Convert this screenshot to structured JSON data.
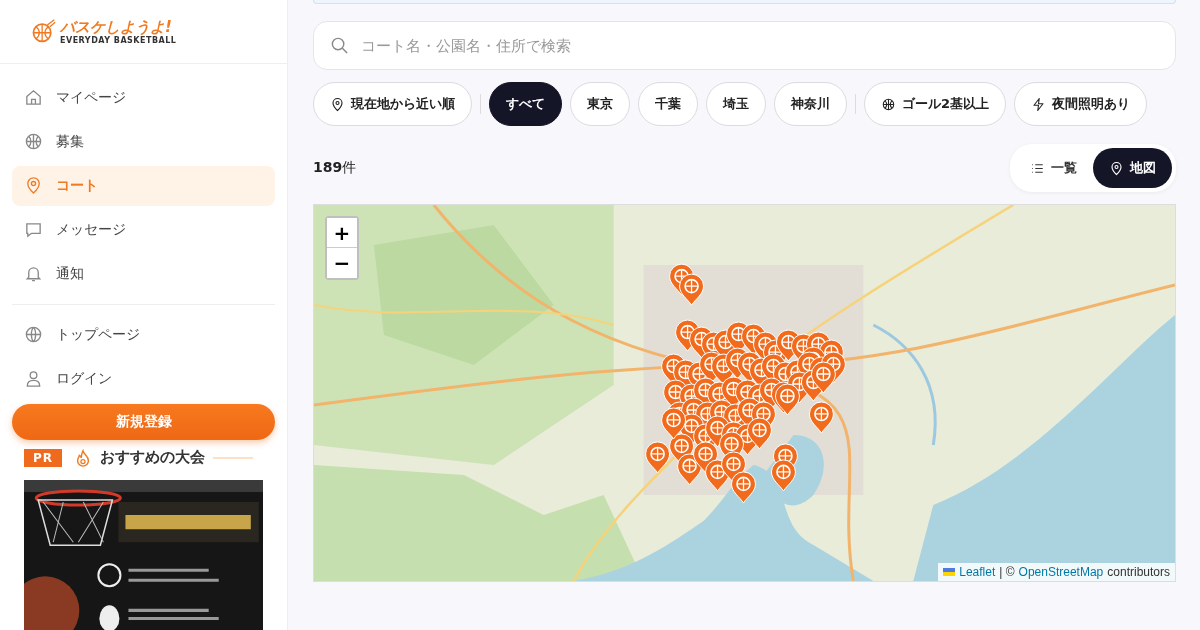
{
  "logo": {
    "title": "バスケしようよ!",
    "tagline": "EVERYDAY BASKETBALL"
  },
  "sidebar": {
    "items": [
      {
        "label": "マイページ",
        "kind": "home",
        "selected": false
      },
      {
        "label": "募集",
        "kind": "ball",
        "selected": false
      },
      {
        "label": "コート",
        "kind": "pin",
        "selected": true
      },
      {
        "label": "メッセージ",
        "kind": "chat",
        "selected": false
      },
      {
        "label": "通知",
        "kind": "bell",
        "selected": false
      },
      {
        "label": "トップページ",
        "kind": "globe",
        "selected": false
      },
      {
        "label": "ログイン",
        "kind": "user",
        "selected": false
      }
    ],
    "signup_button": "新規登録",
    "pr": {
      "badge": "PR",
      "title": "おすすめの大会"
    }
  },
  "search": {
    "placeholder": "コート名・公園名・住所で検索"
  },
  "filters": [
    {
      "label": "現在地から近い順",
      "kind": "sort",
      "selected": false
    },
    {
      "label": "すべて",
      "kind": "region",
      "selected": true
    },
    {
      "label": "東京",
      "kind": "region",
      "selected": false
    },
    {
      "label": "千葉",
      "kind": "region",
      "selected": false
    },
    {
      "label": "埼玉",
      "kind": "region",
      "selected": false
    },
    {
      "label": "神奈川",
      "kind": "region",
      "selected": false
    },
    {
      "label": "ゴール2基以上",
      "kind": "goals",
      "selected": false
    },
    {
      "label": "夜間照明あり",
      "kind": "lights",
      "selected": false
    }
  ],
  "result_count": {
    "number": "189",
    "unit": "件"
  },
  "view_toggle": [
    {
      "label": "一覧",
      "kind": "list",
      "selected": false
    },
    {
      "label": "地図",
      "kind": "map",
      "selected": true
    }
  ],
  "map": {
    "zoom_in": "+",
    "zoom_out": "−",
    "attribution": {
      "library": "Leaflet",
      "separator": "| ©",
      "source": "OpenStreetMap",
      "suffix": "contributors"
    }
  }
}
